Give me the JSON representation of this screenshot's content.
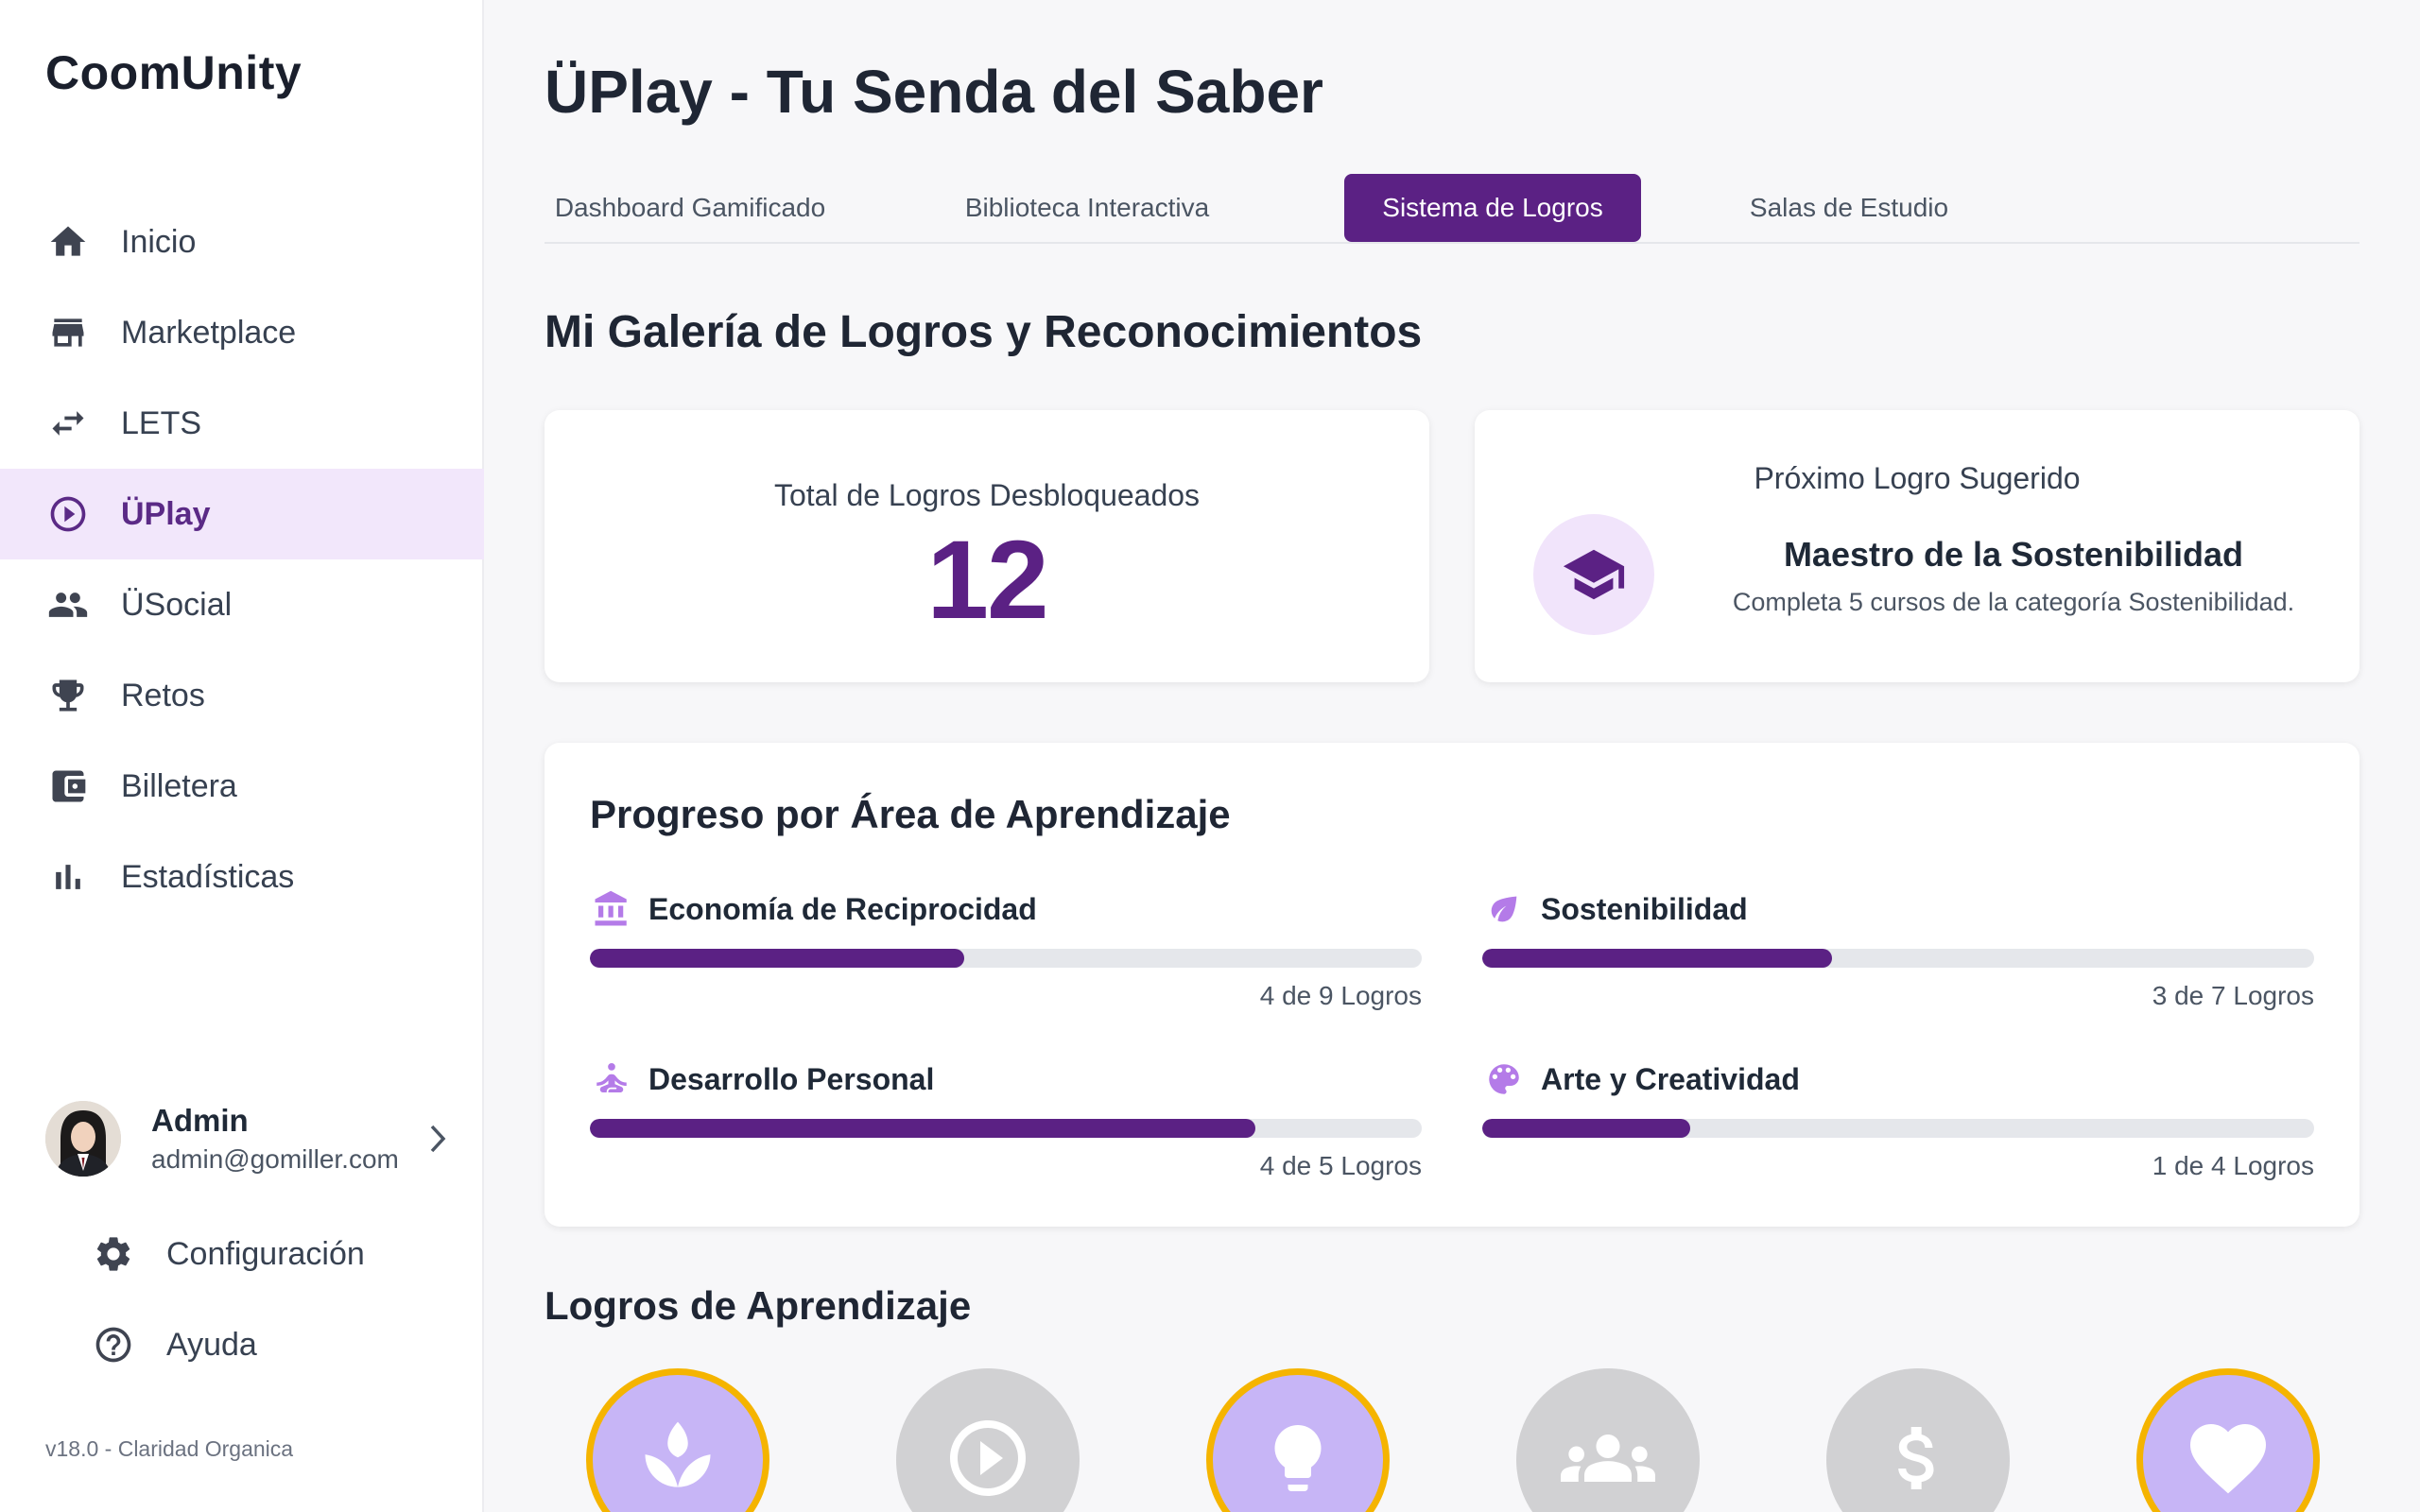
{
  "app": {
    "brand": "CoomUnity",
    "version": "v18.0 - Claridad Organica"
  },
  "sidebar": {
    "items": [
      {
        "label": "Inicio",
        "icon": "home-icon"
      },
      {
        "label": "Marketplace",
        "icon": "store-icon"
      },
      {
        "label": "LETS",
        "icon": "swap-icon"
      },
      {
        "label": "ÜPlay",
        "icon": "play-circle-icon",
        "active": true
      },
      {
        "label": "ÜSocial",
        "icon": "people-icon"
      },
      {
        "label": "Retos",
        "icon": "trophy-icon"
      },
      {
        "label": "Billetera",
        "icon": "wallet-icon"
      },
      {
        "label": "Estadísticas",
        "icon": "bar-chart-icon"
      }
    ],
    "user": {
      "name": "Admin",
      "email": "admin@gomiller.com"
    },
    "settings_label": "Configuración",
    "help_label": "Ayuda"
  },
  "header": {
    "title": "ÜPlay - Tu Senda del Saber"
  },
  "tabs": [
    {
      "label": "Dashboard Gamificado"
    },
    {
      "label": "Biblioteca Interactiva"
    },
    {
      "label": "Sistema de Logros",
      "active": true
    },
    {
      "label": "Salas de Estudio"
    }
  ],
  "gallery": {
    "title": "Mi Galería de Logros y Reconocimientos",
    "total_label": "Total de Logros Desbloqueados",
    "total_value": "12",
    "next_label": "Próximo Logro Sugerido",
    "next_title": "Maestro de la Sostenibilidad",
    "next_desc": "Completa 5 cursos de la categoría Sostenibilidad."
  },
  "progress": {
    "title": "Progreso por Área de Aprendizaje",
    "areas": [
      {
        "name": "Economía de Reciprocidad",
        "icon": "bank-icon",
        "count_label": "4 de 9 Logros",
        "fraction": 0.45
      },
      {
        "name": "Sostenibilidad",
        "icon": "leaf-icon",
        "count_label": "3 de 7 Logros",
        "fraction": 0.42
      },
      {
        "name": "Desarrollo Personal",
        "icon": "meditation-icon",
        "count_label": "4 de 5 Logros",
        "fraction": 0.8
      },
      {
        "name": "Arte y Creatividad",
        "icon": "palette-icon",
        "count_label": "1 de 4 Logros",
        "fraction": 0.25
      }
    ]
  },
  "achievements": {
    "title": "Logros de Aprendizaje",
    "badges": [
      {
        "icon": "sprout-icon",
        "unlocked": true
      },
      {
        "icon": "play-circle-icon",
        "unlocked": false
      },
      {
        "icon": "lightbulb-icon",
        "unlocked": true
      },
      {
        "icon": "group-icon",
        "unlocked": false
      },
      {
        "icon": "dollar-icon",
        "unlocked": false
      },
      {
        "icon": "heart-icon",
        "unlocked": true
      }
    ]
  },
  "colors": {
    "primary": "#5b2184",
    "accent_light": "#f2e7fb",
    "badge_gold": "#f5b400",
    "badge_purple": "#c7b5f6",
    "area_icon": "#b47be8"
  }
}
